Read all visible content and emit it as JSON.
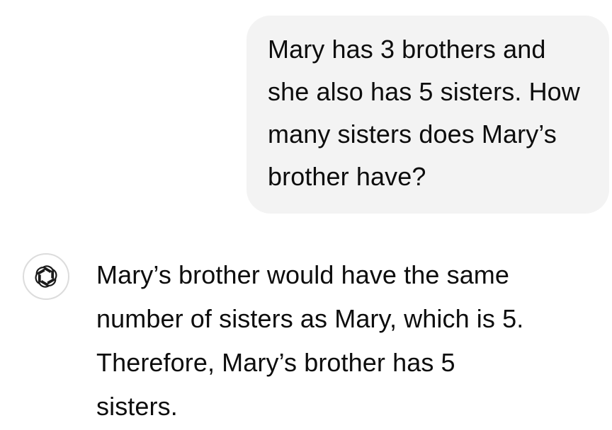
{
  "conversation": {
    "user_message": {
      "text": "Mary has 3 brothers and\nshe also has 5 sisters. How\nmany sisters does Mary’s\nbrother have?"
    },
    "assistant_message": {
      "avatar_icon": "openai-logo-icon",
      "text": "Mary’s brother would have the same\nnumber of sisters as Mary, which is 5.\nTherefore, Mary’s brother has 5\nsisters."
    }
  }
}
